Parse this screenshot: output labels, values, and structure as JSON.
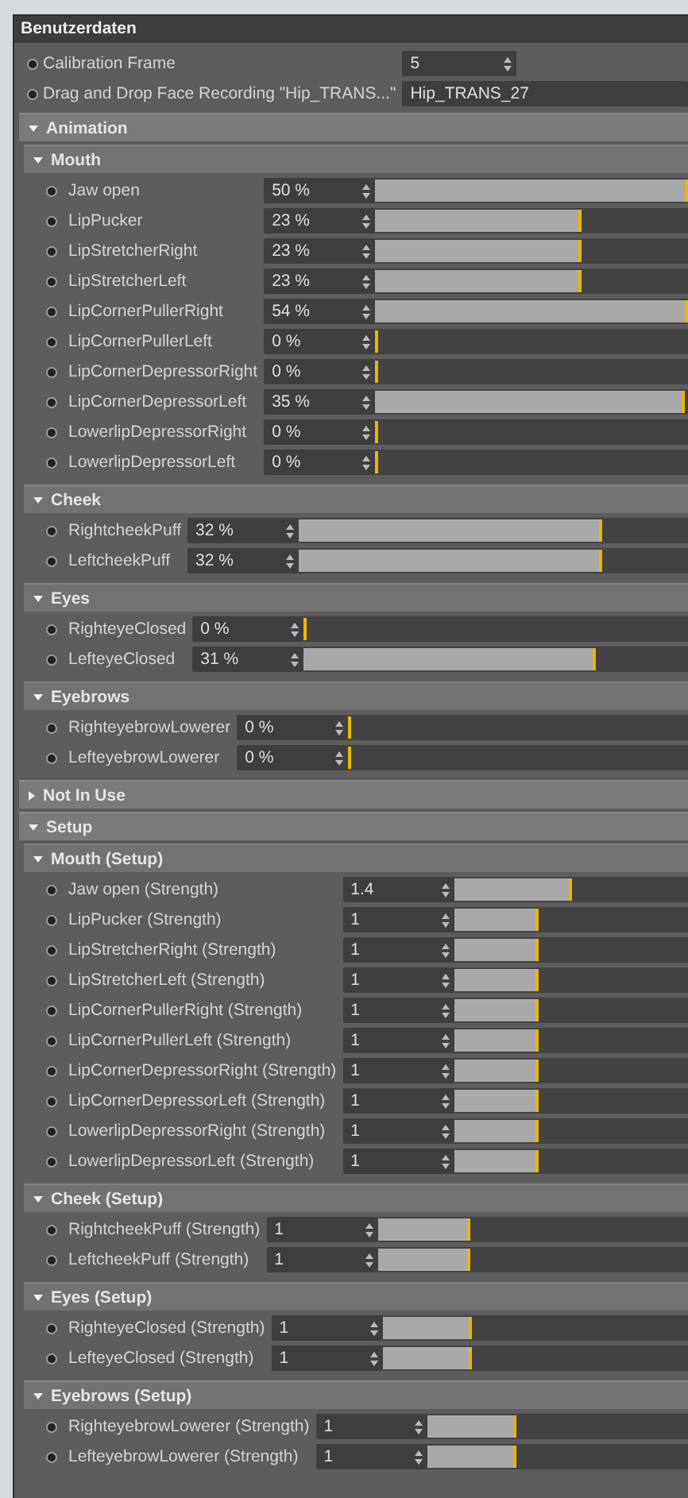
{
  "title": "Benutzerdaten",
  "params": [
    {
      "kind": "number",
      "label": "Calibration Frame",
      "value": "5"
    },
    {
      "kind": "text",
      "label": "Drag and Drop Face Recording  \"Hip_TRANS...\"",
      "value": "Hip_TRANS_27"
    }
  ],
  "sections": [
    {
      "title": "Animation",
      "expanded": true,
      "groups": [
        {
          "title": "Mouth",
          "expanded": true,
          "rows": [
            {
              "label": "Jaw open",
              "value": "50 %",
              "level": 1
            },
            {
              "label": "LipPucker",
              "value": "23 %",
              "level": 0.65
            },
            {
              "label": "LipStretcherRight",
              "value": "23 %",
              "level": 0.65
            },
            {
              "label": "LipStretcherLeft",
              "value": "23 %",
              "level": 0.65
            },
            {
              "label": "LipCornerPullerRight",
              "value": "54 %",
              "level": 1
            },
            {
              "label": "LipCornerPullerLeft",
              "value": "0 %",
              "level": 0
            },
            {
              "label": "LipCornerDepressorRight",
              "value": "0 %",
              "level": 0
            },
            {
              "label": "LipCornerDepressorLeft",
              "value": "35 %",
              "level": 0.98
            },
            {
              "label": "LowerlipDepressorRight",
              "value": "0 %",
              "level": 0
            },
            {
              "label": "LowerlipDepressorLeft",
              "value": "0 %",
              "level": 0
            }
          ]
        },
        {
          "title": "Cheek",
          "expanded": true,
          "rows": [
            {
              "label": "RightcheekPuff",
              "value": "32 %",
              "level": 0.77
            },
            {
              "label": "LeftcheekPuff",
              "value": "32 %",
              "level": 0.77
            }
          ]
        },
        {
          "title": "Eyes",
          "expanded": true,
          "rows": [
            {
              "label": "RighteyeClosed",
              "value": "0 %",
              "level": 0
            },
            {
              "label": "LefteyeClosed",
              "value": "31 %",
              "level": 0.75
            }
          ]
        },
        {
          "title": "Eyebrows",
          "expanded": true,
          "rows": [
            {
              "label": "RighteyebrowLowerer",
              "value": "0 %",
              "level": 0
            },
            {
              "label": "LefteyebrowLowerer",
              "value": "0 %",
              "level": 0
            }
          ]
        }
      ]
    },
    {
      "title": "Not In Use",
      "expanded": false
    },
    {
      "title": "Setup",
      "expanded": true,
      "groups": [
        {
          "title": "Mouth (Setup)",
          "expanded": true,
          "rows": [
            {
              "label": "Jaw open (Strength)",
              "value": "1.4",
              "level": 0.49
            },
            {
              "label": "LipPucker (Strength)",
              "value": "1",
              "level": 0.35
            },
            {
              "label": "LipStretcherRight (Strength)",
              "value": "1",
              "level": 0.35
            },
            {
              "label": "LipStretcherLeft (Strength)",
              "value": "1",
              "level": 0.35
            },
            {
              "label": "LipCornerPullerRight (Strength)",
              "value": "1",
              "level": 0.35
            },
            {
              "label": "LipCornerPullerLeft (Strength)",
              "value": "1",
              "level": 0.35
            },
            {
              "label": "LipCornerDepressorRight (Strength)",
              "value": "1",
              "level": 0.35
            },
            {
              "label": "LipCornerDepressorLeft (Strength)",
              "value": "1",
              "level": 0.35
            },
            {
              "label": "LowerlipDepressorRight (Strength)",
              "value": "1",
              "level": 0.35
            },
            {
              "label": "LowerlipDepressorLeft (Strength)",
              "value": "1",
              "level": 0.35
            }
          ]
        },
        {
          "title": "Cheek (Setup)",
          "expanded": true,
          "rows": [
            {
              "label": "RightcheekPuff (Strength)",
              "value": "1",
              "level": 0.29
            },
            {
              "label": "LeftcheekPuff (Strength)",
              "value": "1",
              "level": 0.29
            }
          ]
        },
        {
          "title": "Eyes (Setup)",
          "expanded": true,
          "rows": [
            {
              "label": "RighteyeClosed (Strength)",
              "value": "1",
              "level": 0.28
            },
            {
              "label": "LefteyeClosed (Strength)",
              "value": "1",
              "level": 0.28
            }
          ]
        },
        {
          "title": "Eyebrows (Setup)",
          "expanded": true,
          "rows": [
            {
              "label": "RighteyebrowLowerer (Strength)",
              "value": "1",
              "level": 0.33
            },
            {
              "label": "LefteyebrowLowerer (Strength)",
              "value": "1",
              "level": 0.33
            }
          ]
        }
      ]
    }
  ]
}
